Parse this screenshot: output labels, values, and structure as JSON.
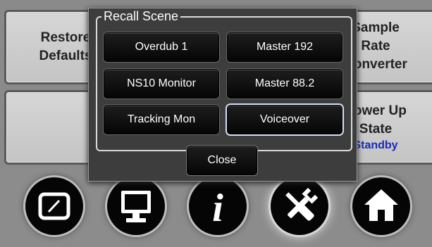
{
  "background_tiles": {
    "restore_defaults": [
      "Restore",
      "Defaults"
    ],
    "sample_rate_converter": [
      "Sample",
      "Rate",
      "Converter"
    ],
    "power_up_state": [
      "Power Up",
      "State"
    ],
    "power_up_value": "Standby"
  },
  "dialog": {
    "title": "Recall Scene",
    "scenes": [
      "Overdub 1",
      "Master 192",
      "NS10 Monitor",
      "Master 88.2",
      "Tracking Mon",
      "Voiceover"
    ],
    "selected_scene": "Voiceover",
    "close_label": "Close"
  },
  "nav": {
    "icons": [
      "gauge-icon",
      "monitor-icon",
      "info-icon",
      "tools-icon",
      "home-icon"
    ],
    "active": "tools-icon",
    "info_glyph": "i"
  },
  "colors": {
    "dialog_bg": "#3d3d3d",
    "tile_bg": "#d0d0d0",
    "standby_text": "#1a2ab4",
    "button_bg": "#0a0a0a",
    "selected_outline": "#d6dff5"
  }
}
